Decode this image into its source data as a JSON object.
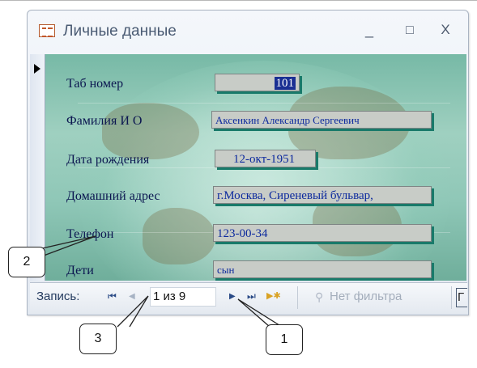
{
  "window": {
    "title": "Личные данные",
    "controls": {
      "minimize": "_",
      "maximize": "□",
      "close": "X"
    }
  },
  "form": {
    "fields": [
      {
        "label": "Таб номер",
        "value": "101"
      },
      {
        "label": "Фамилия И О",
        "value": "Аксенкин Александр Сергеевич"
      },
      {
        "label": "Дата рождения",
        "value": "12-окт-1951"
      },
      {
        "label": "Домашний адрес",
        "value": "г.Москва, Сиреневый бульвар,"
      },
      {
        "label": "Телефон",
        "value": "123-00-34"
      },
      {
        "label": "Дети",
        "value": "сын"
      }
    ]
  },
  "navigation": {
    "label": "Запись:",
    "first": "⏮",
    "prev": "◀",
    "position": "1 из 9",
    "next": "▶",
    "last": "⏭",
    "new": "▶✱",
    "filter_icon": "funnel-icon",
    "filter_label": "Нет фильтра",
    "search_stub": "Г"
  },
  "callouts": [
    "1",
    "2",
    "3"
  ]
}
